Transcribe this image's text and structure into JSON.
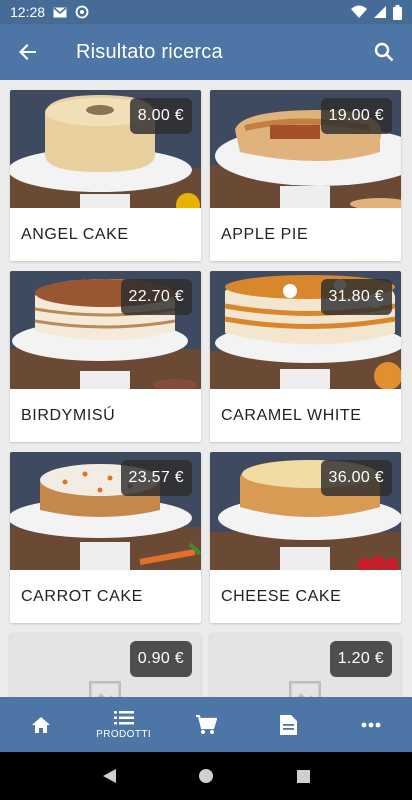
{
  "status_bar": {
    "time": "12:28"
  },
  "app_bar": {
    "title": "Risultato ricerca"
  },
  "products": [
    {
      "name": "ANGEL CAKE",
      "price": "8.00 €"
    },
    {
      "name": "APPLE PIE",
      "price": "19.00 €"
    },
    {
      "name": "BIRDYMISÚ",
      "price": "22.70 €"
    },
    {
      "name": "CARAMEL WHITE",
      "price": "31.80 €"
    },
    {
      "name": "CARROT CAKE",
      "price": "23.57 €"
    },
    {
      "name": "CHEESE CAKE",
      "price": "36.00 €"
    },
    {
      "name": "",
      "price": "0.90 €"
    },
    {
      "name": "",
      "price": "1.20 €"
    }
  ],
  "bottom_nav": {
    "active": "PRODOTTI",
    "items": [
      {
        "icon": "home-icon"
      },
      {
        "icon": "list-icon",
        "label": "PRODOTTI"
      },
      {
        "icon": "cart-icon"
      },
      {
        "icon": "document-icon"
      },
      {
        "icon": "more-icon"
      }
    ]
  },
  "colors": {
    "primary": "#4d76a6",
    "status": "#476b97",
    "price_badge": "#2d2d2d"
  }
}
